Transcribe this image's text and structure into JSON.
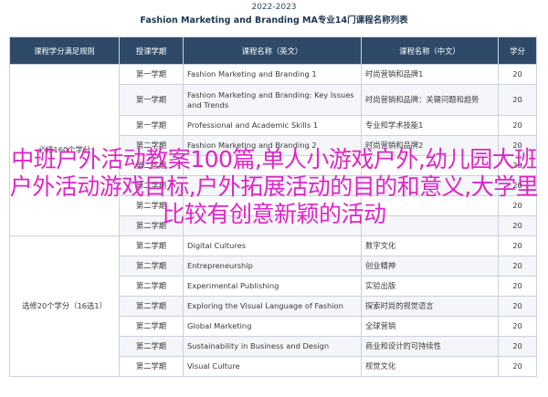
{
  "header": {
    "year": "2022-2023",
    "title": "Fashion Marketing and Branding MA专业14门课程名称列表"
  },
  "table": {
    "columns": [
      "课程学分满足规则",
      "授课学期",
      "课程名称（英文）",
      "课程名称（中文）",
      "学分"
    ],
    "groups": [
      {
        "label": "必修160个学分",
        "rowspan": 8
      },
      {
        "label": "选修20个学分（16选1）",
        "rowspan": 7
      }
    ],
    "rows": [
      {
        "semester": "第一学期",
        "en": "Fashion Marketing and Branding 1",
        "zh": "时尚营销和品牌1",
        "credit": "20"
      },
      {
        "semester": "第一学期",
        "en": "Fashion Marketing and Branding: Key Issues and Trends",
        "zh": "时尚营销和品牌：关键问题和趋势",
        "credit": "20"
      },
      {
        "semester": "第一学期",
        "en": "Professional and Academic Skills 1",
        "zh": "专业和学术技能1",
        "credit": "20"
      },
      {
        "semester": "第二学期",
        "en": "Fashion Marketing and Branding 2",
        "zh": "时尚营销和品牌2",
        "credit": "20"
      },
      {
        "semester": "第二学期",
        "en": "",
        "zh": "",
        "credit": "20"
      },
      {
        "semester": "第二学期",
        "en": "",
        "zh": "",
        "credit": "20"
      },
      {
        "semester": "第二学期",
        "en": "",
        "zh": "",
        "credit": "20"
      },
      {
        "semester": "第二学期",
        "en": "",
        "zh": "",
        "credit": "20"
      },
      {
        "semester": "第二学期",
        "en": "Digital Cultures",
        "zh": "数字文化",
        "credit": "20"
      },
      {
        "semester": "第二学期",
        "en": "Entrepreneurship",
        "zh": "创业精神",
        "credit": "20"
      },
      {
        "semester": "第二学期",
        "en": "Experimental Publishing",
        "zh": "实验出版",
        "credit": "20"
      },
      {
        "semester": "第二学期",
        "en": "Exploring the Visual Language of Fashion",
        "zh": "探索时尚的视觉语言",
        "credit": "20"
      },
      {
        "semester": "第二学期",
        "en": "Global Marketing",
        "zh": "全球营销",
        "credit": "20"
      },
      {
        "semester": "第二学期",
        "en": "Sustainability in Business and Design",
        "zh": "商业和设计的可持续性",
        "credit": "20"
      },
      {
        "semester": "第二学期",
        "en": "Visual Culture",
        "zh": "视觉文化",
        "credit": "20"
      }
    ]
  },
  "overlay_text": "中班户外活动教案100篇,单人小游戏户外,幼儿园大班户外活动游戏目标,户外拓展活动的目的和意义,大学里比较有创意新颖的活动"
}
